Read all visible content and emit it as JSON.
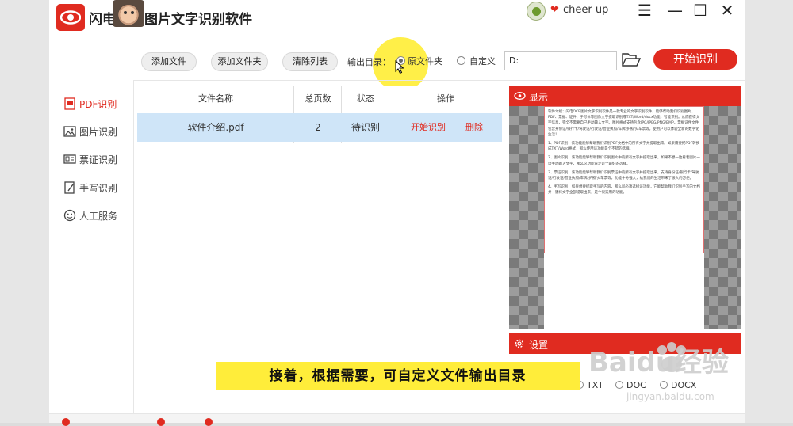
{
  "app": {
    "title_part1": "闪电",
    "title_part2": "图片文字识别软件"
  },
  "user": {
    "name": "cheer up"
  },
  "window_controls": {
    "menu": "☰",
    "minimize": "—",
    "maximize": "☐",
    "close": "✕"
  },
  "toolbar": {
    "add_file": "添加文件",
    "add_folder": "添加文件夹",
    "clear_list": "清除列表",
    "output_dir_label": "输出目录：",
    "option_original": "原文件夹",
    "option_custom": "自定义",
    "path_value": "D:",
    "start": "开始识别"
  },
  "sidebar": {
    "items": [
      {
        "label": "PDF识别",
        "icon": "pdf-icon",
        "active": true
      },
      {
        "label": "图片识别",
        "icon": "image-icon",
        "active": false
      },
      {
        "label": "票证识别",
        "icon": "ticket-icon",
        "active": false
      },
      {
        "label": "手写识别",
        "icon": "handwriting-icon",
        "active": false
      },
      {
        "label": "人工服务",
        "icon": "smile-icon",
        "active": false
      }
    ]
  },
  "table": {
    "headers": [
      "文件名称",
      "总页数",
      "状态",
      "操作"
    ],
    "rows": [
      {
        "filename": "软件介绍.pdf",
        "pages": "2",
        "status": "待识别",
        "action_start": "开始识别",
        "action_delete": "删除"
      }
    ]
  },
  "preview": {
    "title": "显示",
    "paragraphs": [
      "软件介绍：闪电OCR图片文字识别软件是一款专业的文字识别软件，能够帮助我们识别图片、PDF、票据、证件、手写体等图像文字提取识别成TXT/Word/docx功能，智能识别。从而获得文字信息，完全不需要自己手动输入文字。图片格式支持包含JPG/JPEG/PNG/BMP。票据证件文件包含身份证/银行卡/驾驶证/行驶证/营业执照/车牌/护照/火车票等。使用户可以体验全新的数字化生活！",
      "1、PDF识别：该功能能够帮助我们识别PDF文档中的所有文字并提取出来。如果需要把PDF转换成TXT/Word格式，那么使用该功能是个不错的选择。",
      "2、图片识别：该功能能够帮助我们识别图片中的所有文字并提取出来，如果不想一边看着图片一边手动输入文字，那么这功能肯定是个最好的选择。",
      "3、票证识别：该功能能够帮助我们识别票证中的所有文字并提取出来，支持身份证/银行卡/驾驶证/行驶证/营业执照/车牌/护照/火车票等，功能十分强大，给我们的生活带来了很大的方便。",
      "4、手写识别：如果想要提取手写的内容，那么就必须选择该功能，它能帮助我们识别手写的文档并一键将文字全部提取出来，是个很实用的功能。"
    ]
  },
  "settings": {
    "title": "设置",
    "formats": [
      "TXT",
      "DOC",
      "DOCX"
    ]
  },
  "watermark": {
    "main": "Baidu经验",
    "sub": "jingyan.baidu.com"
  },
  "caption": "接着，根据需要，可自定义文件输出目录",
  "colors": {
    "accent": "#e02b20",
    "selected_row": "#cfe5f8",
    "highlight": "#ffed3a"
  }
}
